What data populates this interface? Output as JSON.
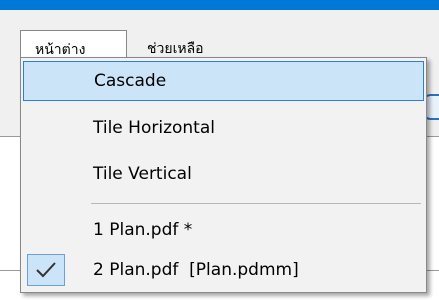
{
  "menubar": {
    "items": [
      {
        "label": "หน้าต่าง"
      },
      {
        "label": "ช่วยเหลือ"
      }
    ]
  },
  "window_menu": {
    "items": [
      {
        "label": "Cascade",
        "highlighted": true
      },
      {
        "label": "Tile Horizontal"
      },
      {
        "label": "Tile Vertical"
      },
      {
        "label": "1 Plan.pdf *"
      },
      {
        "label": "2 Plan.pdf  [Plan.pdmm]",
        "checked": true
      }
    ]
  },
  "icons": {
    "check": "checkmark-icon",
    "toolbar": "toolbar-icon-partial"
  },
  "colors": {
    "title_strip": "#0078d7",
    "highlight_bg": "#cce4f7",
    "highlight_border": "#2f7fd1"
  }
}
